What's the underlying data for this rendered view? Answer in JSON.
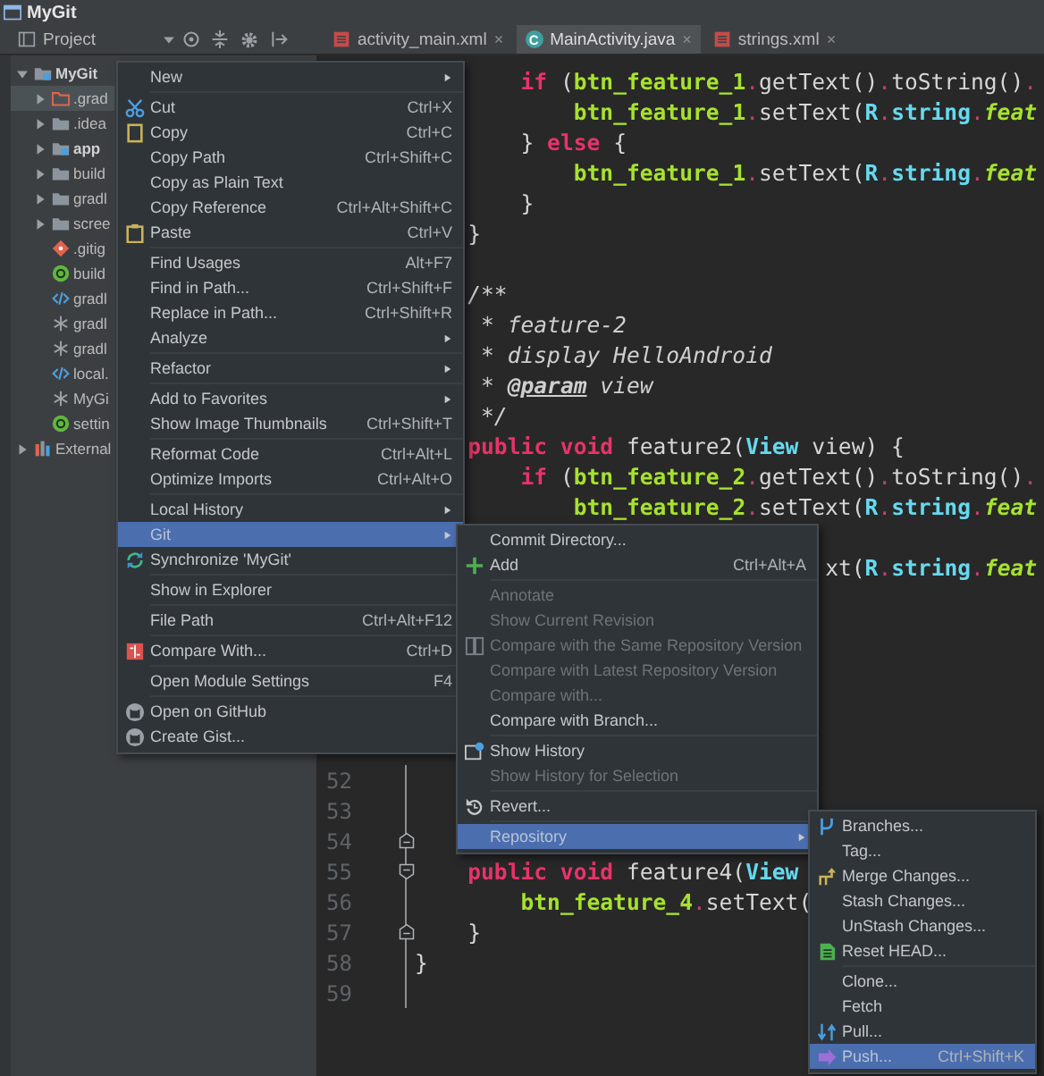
{
  "window": {
    "title": "MyGit"
  },
  "project_panel": {
    "title": "Project",
    "tree": [
      {
        "label": "MyGit",
        "kind": "module",
        "expanded": true,
        "selected": false,
        "children": [
          {
            "label": ".grad",
            "kind": "excluded-folder",
            "expanded": false,
            "selected": true
          },
          {
            "label": ".idea",
            "kind": "folder",
            "expanded": false,
            "selected": false
          },
          {
            "label": "app",
            "kind": "module",
            "expanded": false,
            "selected": false
          },
          {
            "label": "build",
            "kind": "folder",
            "expanded": false,
            "selected": false
          },
          {
            "label": "gradl",
            "kind": "folder",
            "expanded": false,
            "selected": false
          },
          {
            "label": "scree",
            "kind": "folder",
            "expanded": false,
            "selected": false
          },
          {
            "label": ".gitig",
            "kind": "git-file",
            "selected": false
          },
          {
            "label": "build",
            "kind": "gradle-file",
            "selected": false
          },
          {
            "label": "gradl",
            "kind": "xml-file",
            "selected": false
          },
          {
            "label": "gradl",
            "kind": "properties-file",
            "selected": false
          },
          {
            "label": "gradl",
            "kind": "properties-file",
            "selected": false
          },
          {
            "label": "local.",
            "kind": "xml-file",
            "selected": false
          },
          {
            "label": "MyGi",
            "kind": "properties-file",
            "selected": false
          },
          {
            "label": "settin",
            "kind": "gradle-file",
            "selected": false
          }
        ]
      },
      {
        "label": "External",
        "kind": "library",
        "expanded": false,
        "selected": false
      }
    ]
  },
  "tabs": [
    {
      "label": "activity_main.xml",
      "kind": "xml",
      "close": "×",
      "selected": false
    },
    {
      "label": "MainActivity.java",
      "kind": "class",
      "icon_text": "C",
      "close": "×",
      "selected": true
    },
    {
      "label": "strings.xml",
      "kind": "xml",
      "close": "×",
      "selected": false
    }
  ],
  "editor": {
    "blocks": [
      {
        "lines": [
          {
            "tokens": [
              {
                "kind": "keyword",
                "text": "        if"
              },
              {
                "kind": "plain",
                "text": " ("
              },
              {
                "kind": "field",
                "text": "btn_feature_1"
              },
              {
                "kind": "dot",
                "text": "."
              },
              {
                "kind": "plain",
                "text": "getText()"
              },
              {
                "kind": "dot",
                "text": "."
              },
              {
                "kind": "plain",
                "text": "toString()"
              },
              {
                "kind": "dot",
                "text": "."
              }
            ]
          },
          {
            "tokens": [
              {
                "kind": "field",
                "text": "            btn_feature_1"
              },
              {
                "kind": "dot",
                "text": "."
              },
              {
                "kind": "plain",
                "text": "setText("
              },
              {
                "kind": "type",
                "text": "R"
              },
              {
                "kind": "dot",
                "text": "."
              },
              {
                "kind": "type",
                "text": "string"
              },
              {
                "kind": "dot",
                "text": "."
              },
              {
                "kind": "static-field",
                "text": "feat"
              }
            ]
          },
          {
            "tokens": [
              {
                "kind": "plain",
                "text": "        } "
              },
              {
                "kind": "keyword",
                "text": "else"
              },
              {
                "kind": "plain",
                "text": " {"
              }
            ]
          },
          {
            "tokens": [
              {
                "kind": "field",
                "text": "            btn_feature_1"
              },
              {
                "kind": "dot",
                "text": "."
              },
              {
                "kind": "plain",
                "text": "setText("
              },
              {
                "kind": "type",
                "text": "R"
              },
              {
                "kind": "dot",
                "text": "."
              },
              {
                "kind": "type",
                "text": "string"
              },
              {
                "kind": "dot",
                "text": "."
              },
              {
                "kind": "static-field",
                "text": "feat"
              }
            ]
          },
          {
            "tokens": [
              {
                "kind": "plain",
                "text": "        }"
              }
            ]
          },
          {
            "tokens": [
              {
                "kind": "plain",
                "text": "    }"
              }
            ]
          }
        ]
      },
      {
        "lines": [
          {
            "tokens": [
              {
                "kind": "comment",
                "text": "    /**"
              }
            ]
          },
          {
            "tokens": [
              {
                "kind": "comment",
                "text": "     * feature-2"
              }
            ]
          },
          {
            "tokens": [
              {
                "kind": "comment",
                "text": "     * display HelloAndroid"
              }
            ]
          },
          {
            "tokens": [
              {
                "kind": "comment",
                "text": "     * "
              },
              {
                "kind": "doc-tag",
                "text": "@param"
              },
              {
                "kind": "comment",
                "text": " view"
              }
            ]
          },
          {
            "tokens": [
              {
                "kind": "comment",
                "text": "     */"
              }
            ]
          },
          {
            "tokens": [
              {
                "kind": "keyword",
                "text": "    public void"
              },
              {
                "kind": "plain",
                "text": " feature2("
              },
              {
                "kind": "type",
                "text": "View"
              },
              {
                "kind": "plain",
                "text": " view) {"
              }
            ]
          },
          {
            "tokens": [
              {
                "kind": "keyword",
                "text": "        if"
              },
              {
                "kind": "plain",
                "text": " ("
              },
              {
                "kind": "field",
                "text": "btn_feature_2"
              },
              {
                "kind": "dot",
                "text": "."
              },
              {
                "kind": "plain",
                "text": "getText()"
              },
              {
                "kind": "dot",
                "text": "."
              },
              {
                "kind": "plain",
                "text": "toString()"
              },
              {
                "kind": "dot",
                "text": "."
              }
            ]
          },
          {
            "tokens": [
              {
                "kind": "field",
                "text": "            btn_feature_2"
              },
              {
                "kind": "dot",
                "text": "."
              },
              {
                "kind": "plain",
                "text": "setText("
              },
              {
                "kind": "type",
                "text": "R"
              },
              {
                "kind": "dot",
                "text": "."
              },
              {
                "kind": "type",
                "text": "string"
              },
              {
                "kind": "dot",
                "text": "."
              },
              {
                "kind": "static-field",
                "text": "feat"
              }
            ]
          }
        ]
      },
      {
        "lines": [
          {
            "tokens": [
              {
                "kind": "plain",
                "text": "                               xt("
              },
              {
                "kind": "type",
                "text": "R"
              },
              {
                "kind": "dot",
                "text": "."
              },
              {
                "kind": "type",
                "text": "string"
              },
              {
                "kind": "dot",
                "text": "."
              },
              {
                "kind": "static-field",
                "text": "feat"
              }
            ]
          }
        ]
      },
      {
        "lines": [
          {
            "kind": "plain",
            "number": "52"
          },
          {
            "kind": "plain",
            "number": "53"
          },
          {
            "kind": "fold-end",
            "number": "54"
          },
          {
            "kind": "fold-start",
            "number": "55",
            "tokens": [
              {
                "kind": "keyword",
                "text": "    public void"
              },
              {
                "kind": "plain",
                "text": " feature4("
              },
              {
                "kind": "type",
                "text": "View"
              }
            ]
          },
          {
            "kind": "plain",
            "number": "56",
            "tokens": [
              {
                "kind": "field",
                "text": "        btn_feature_4"
              },
              {
                "kind": "dot",
                "text": "."
              },
              {
                "kind": "plain",
                "text": "setText("
              }
            ]
          },
          {
            "kind": "fold-end",
            "number": "57",
            "tokens": [
              {
                "kind": "plain",
                "text": "    }"
              }
            ]
          },
          {
            "kind": "plain",
            "number": "58",
            "tokens": [
              {
                "kind": "plain",
                "text": "}"
              }
            ]
          },
          {
            "kind": "plain",
            "number": "59"
          }
        ]
      }
    ]
  },
  "context_menu": {
    "items": [
      {
        "kind": "submenu",
        "label": "New",
        "selected": false
      },
      {
        "kind": "separator"
      },
      {
        "kind": "item",
        "label": "Cut",
        "shortcut": "Ctrl+X",
        "selected": false
      },
      {
        "kind": "item",
        "label": "Copy",
        "shortcut": "Ctrl+C",
        "selected": false
      },
      {
        "kind": "item",
        "label": "Copy Path",
        "shortcut": "Ctrl+Shift+C",
        "selected": false
      },
      {
        "kind": "item",
        "label": "Copy as Plain Text",
        "selected": false
      },
      {
        "kind": "item",
        "label": "Copy Reference",
        "shortcut": "Ctrl+Alt+Shift+C",
        "selected": false
      },
      {
        "kind": "item",
        "label": "Paste",
        "shortcut": "Ctrl+V",
        "selected": false
      },
      {
        "kind": "separator"
      },
      {
        "kind": "item",
        "label": "Find Usages",
        "shortcut": "Alt+F7",
        "selected": false
      },
      {
        "kind": "item",
        "label": "Find in Path...",
        "shortcut": "Ctrl+Shift+F",
        "selected": false
      },
      {
        "kind": "item",
        "label": "Replace in Path...",
        "shortcut": "Ctrl+Shift+R",
        "selected": false
      },
      {
        "kind": "submenu",
        "label": "Analyze",
        "selected": false
      },
      {
        "kind": "separator"
      },
      {
        "kind": "submenu",
        "label": "Refactor",
        "selected": false
      },
      {
        "kind": "separator"
      },
      {
        "kind": "submenu",
        "label": "Add to Favorites",
        "selected": false
      },
      {
        "kind": "item",
        "label": "Show Image Thumbnails",
        "shortcut": "Ctrl+Shift+T",
        "selected": false
      },
      {
        "kind": "separator"
      },
      {
        "kind": "item",
        "label": "Reformat Code",
        "shortcut": "Ctrl+Alt+L",
        "selected": false
      },
      {
        "kind": "item",
        "label": "Optimize Imports",
        "shortcut": "Ctrl+Alt+O",
        "selected": false
      },
      {
        "kind": "separator"
      },
      {
        "kind": "submenu",
        "label": "Local History",
        "selected": false
      },
      {
        "kind": "submenu",
        "label": "Git",
        "selected": true
      },
      {
        "kind": "item",
        "label": "Synchronize 'MyGit'",
        "selected": false
      },
      {
        "kind": "separator"
      },
      {
        "kind": "item",
        "label": "Show in Explorer",
        "selected": false
      },
      {
        "kind": "separator"
      },
      {
        "kind": "item",
        "label": "File Path",
        "shortcut": "Ctrl+Alt+F12",
        "selected": false
      },
      {
        "kind": "separator"
      },
      {
        "kind": "item",
        "label": "Compare With...",
        "shortcut": "Ctrl+D",
        "selected": false
      },
      {
        "kind": "separator"
      },
      {
        "kind": "item",
        "label": "Open Module Settings",
        "shortcut": "F4",
        "selected": false
      },
      {
        "kind": "separator"
      },
      {
        "kind": "item",
        "label": "Open on GitHub",
        "selected": false
      },
      {
        "kind": "item",
        "label": "Create Gist...",
        "selected": false
      }
    ]
  },
  "git_menu": {
    "items": [
      {
        "kind": "item",
        "label": "Commit Directory...",
        "selected": false,
        "disabled": false
      },
      {
        "kind": "item",
        "label": "Add",
        "shortcut": "Ctrl+Alt+A",
        "selected": false,
        "disabled": false
      },
      {
        "kind": "separator"
      },
      {
        "kind": "item",
        "label": "Annotate",
        "selected": false,
        "disabled": true
      },
      {
        "kind": "item",
        "label": "Show Current Revision",
        "selected": false,
        "disabled": true
      },
      {
        "kind": "item",
        "label": "Compare with the Same Repository Version",
        "selected": false,
        "disabled": true
      },
      {
        "kind": "item",
        "label": "Compare with Latest Repository Version",
        "selected": false,
        "disabled": true
      },
      {
        "kind": "item",
        "label": "Compare with...",
        "selected": false,
        "disabled": true
      },
      {
        "kind": "item",
        "label": "Compare with Branch...",
        "selected": false,
        "disabled": false
      },
      {
        "kind": "separator"
      },
      {
        "kind": "item",
        "label": "Show History",
        "selected": false,
        "disabled": false
      },
      {
        "kind": "item",
        "label": "Show History for Selection",
        "selected": false,
        "disabled": true
      },
      {
        "kind": "separator"
      },
      {
        "kind": "item",
        "label": "Revert...",
        "selected": false,
        "disabled": false
      },
      {
        "kind": "separator"
      },
      {
        "kind": "submenu",
        "label": "Repository",
        "selected": true,
        "disabled": false
      }
    ]
  },
  "repository_menu": {
    "items": [
      {
        "kind": "item",
        "label": "Branches...",
        "selected": false
      },
      {
        "kind": "item",
        "label": "Tag...",
        "selected": false
      },
      {
        "kind": "item",
        "label": "Merge Changes...",
        "selected": false
      },
      {
        "kind": "item",
        "label": "Stash Changes...",
        "selected": false
      },
      {
        "kind": "item",
        "label": "UnStash Changes...",
        "selected": false
      },
      {
        "kind": "item",
        "label": "Reset HEAD...",
        "selected": false
      },
      {
        "kind": "separator"
      },
      {
        "kind": "item",
        "label": "Clone...",
        "selected": false
      },
      {
        "kind": "item",
        "label": "Fetch",
        "selected": false
      },
      {
        "kind": "item",
        "label": "Pull...",
        "selected": false
      },
      {
        "kind": "item",
        "label": "Push...",
        "shortcut": "Ctrl+Shift+K",
        "selected": true
      }
    ]
  }
}
